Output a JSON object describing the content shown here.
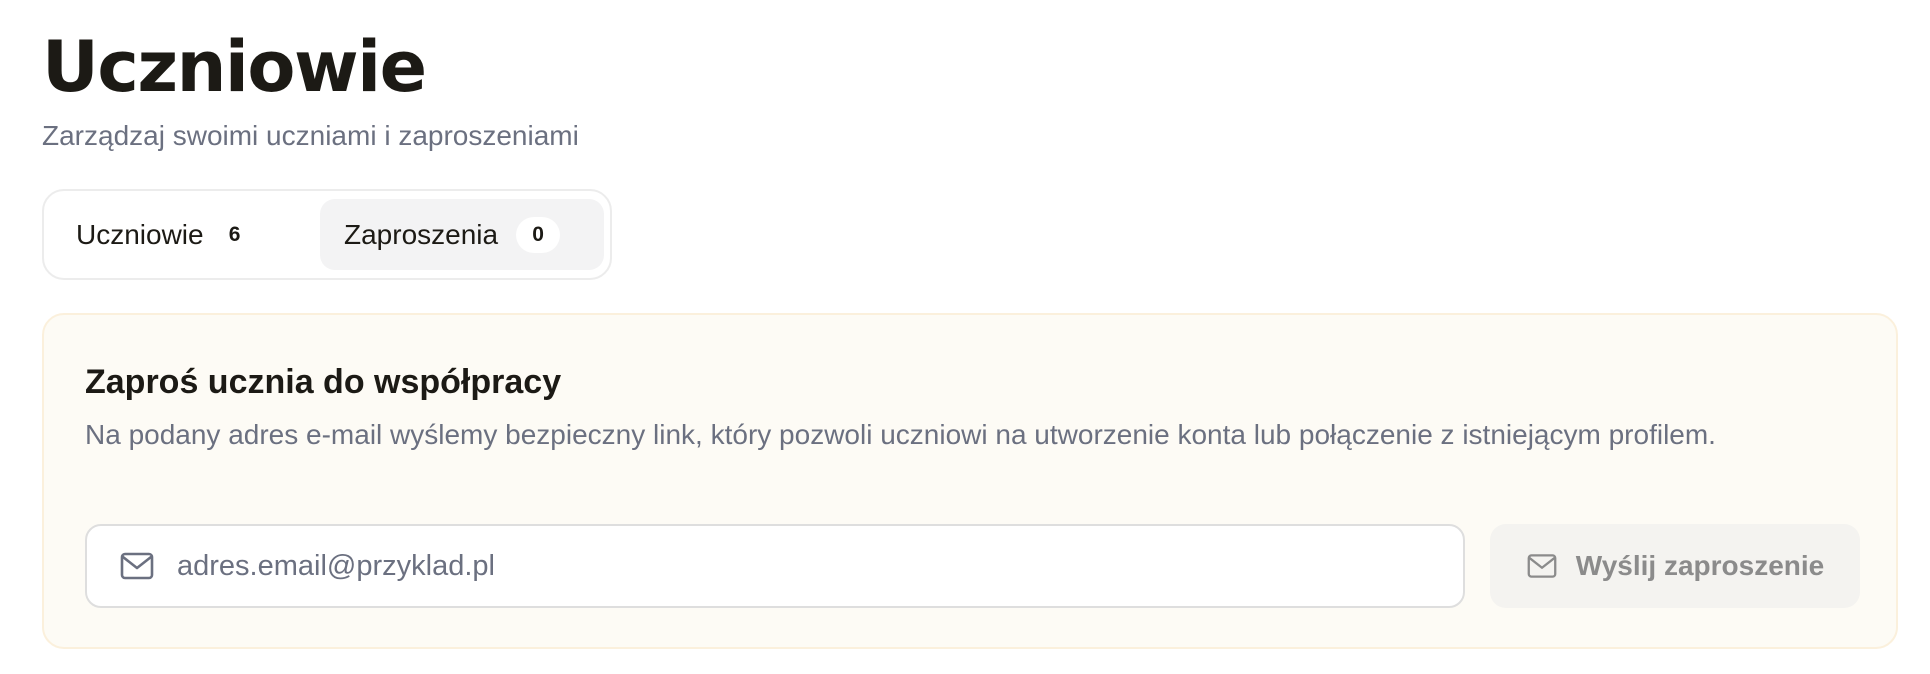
{
  "header": {
    "title": "Uczniowie",
    "subtitle": "Zarządzaj swoimi uczniami i zaproszeniami"
  },
  "tabs": [
    {
      "label": "Uczniowie",
      "count": "6",
      "active": false
    },
    {
      "label": "Zaproszenia",
      "count": "0",
      "active": true
    }
  ],
  "invite": {
    "title": "Zaproś ucznia do współpracy",
    "description": "Na podany adres e-mail wyślemy bezpieczny link, który pozwoli uczniowi na utworzenie konta lub połączenie z istniejącym profilem.",
    "email_value": "",
    "email_placeholder": "adres.email@przyklad.pl",
    "email_icon": "mail-icon",
    "send_label": "Wyślij zaproszenie",
    "send_icon": "mail-icon"
  },
  "colors": {
    "title_text": "#1c1a15",
    "muted_text": "#6b7080",
    "card_background": "#fdfbf5",
    "card_border": "#fbf0dc",
    "active_tab_background": "#f3f3f4",
    "button_background": "#f4f3f0",
    "button_text": "#8b8b8b"
  }
}
